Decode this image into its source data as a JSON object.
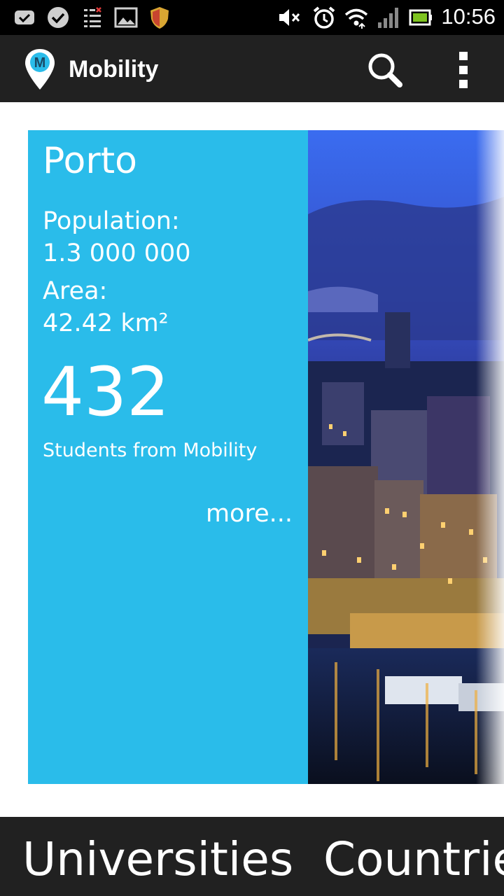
{
  "status_bar": {
    "time": "10:56",
    "left_icons": [
      "message-icon",
      "check-icon",
      "tasks-icon",
      "gallery-icon",
      "shield-icon"
    ],
    "right_icons": [
      "mute-icon",
      "alarm-icon",
      "wifi-icon",
      "signal-icon",
      "battery-icon"
    ]
  },
  "action_bar": {
    "title": "Mobility",
    "logo_letter": "M",
    "accent": "#2abcea",
    "actions": [
      "search-icon",
      "overflow-menu-icon"
    ]
  },
  "city_card": {
    "name": "Porto",
    "population_label": "Population:",
    "population_value": "1.3 000 000",
    "area_label": "Area:",
    "area_value": "42.42 km²",
    "students_count": "432",
    "students_label": "Students from Mobility",
    "more_link": "more...",
    "card_color": "#2abcea"
  },
  "tabs": [
    {
      "label": "Universities"
    },
    {
      "label": "Countries"
    }
  ]
}
